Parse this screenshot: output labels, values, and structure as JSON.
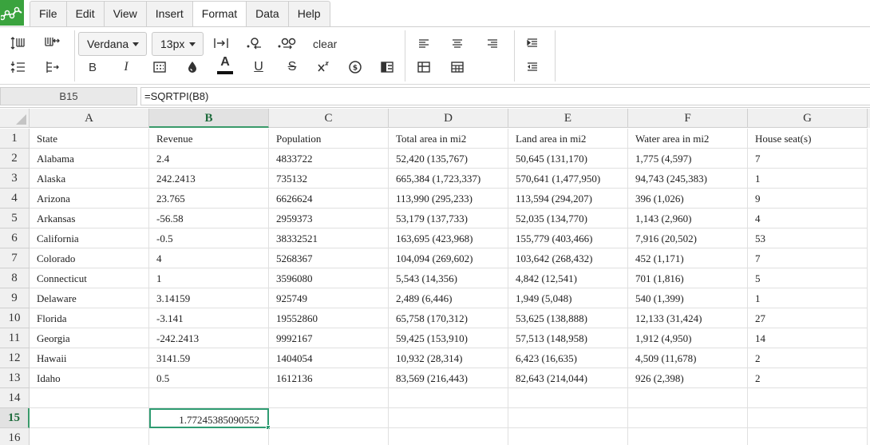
{
  "menu": {
    "tabs": [
      "File",
      "Edit",
      "View",
      "Insert",
      "Format",
      "Data",
      "Help"
    ],
    "active": "Format"
  },
  "toolbar": {
    "font_family": "Verdana",
    "font_size": "13px",
    "clear_label": "clear",
    "bold_label": "B",
    "italic_label": "I",
    "underline_label": "U",
    "strike_label": "S",
    "font_color_label": "A",
    "accent_color": "#3aa33e"
  },
  "formula_bar": {
    "cell_ref": "B15",
    "formula": "=SQRTPI(B8)"
  },
  "sheet": {
    "columns": [
      "A",
      "B",
      "C",
      "D",
      "E",
      "F",
      "G"
    ],
    "selected_column": "B",
    "selected_row": "15",
    "row_numbers": [
      "1",
      "2",
      "3",
      "4",
      "5",
      "6",
      "7",
      "8",
      "9",
      "10",
      "11",
      "12",
      "13",
      "14",
      "15",
      "16"
    ],
    "rows": [
      [
        "State",
        "Revenue",
        "Population",
        "Total area in mi2",
        "Land area in mi2",
        "Water area in mi2",
        "House seat(s)"
      ],
      [
        "Alabama",
        "2.4",
        "4833722",
        "52,420 (135,767)",
        "50,645 (131,170)",
        "1,775 (4,597)",
        "7"
      ],
      [
        "Alaska",
        "242.2413",
        "735132",
        "665,384 (1,723,337)",
        "570,641 (1,477,950)",
        "94,743 (245,383)",
        "1"
      ],
      [
        "Arizona",
        "23.765",
        "6626624",
        "113,990 (295,233)",
        "113,594 (294,207)",
        "396 (1,026)",
        "9"
      ],
      [
        "Arkansas",
        "-56.58",
        "2959373",
        "53,179 (137,733)",
        "52,035 (134,770)",
        "1,143 (2,960)",
        "4"
      ],
      [
        "California",
        "-0.5",
        "38332521",
        "163,695 (423,968)",
        "155,779 (403,466)",
        "7,916 (20,502)",
        "53"
      ],
      [
        "Colorado",
        "4",
        "5268367",
        "104,094 (269,602)",
        "103,642 (268,432)",
        "452 (1,171)",
        "7"
      ],
      [
        "Connecticut",
        "1",
        "3596080",
        "5,543 (14,356)",
        "4,842 (12,541)",
        "701 (1,816)",
        "5"
      ],
      [
        "Delaware",
        "3.14159",
        "925749",
        "2,489 (6,446)",
        "1,949 (5,048)",
        "540 (1,399)",
        "1"
      ],
      [
        "Florida",
        "-3.141",
        "19552860",
        "65,758 (170,312)",
        "53,625 (138,888)",
        "12,133 (31,424)",
        "27"
      ],
      [
        "Georgia",
        "-242.2413",
        "9992167",
        "59,425 (153,910)",
        "57,513 (148,958)",
        "1,912 (4,950)",
        "14"
      ],
      [
        "Hawaii",
        "3141.59",
        "1404054",
        "10,932 (28,314)",
        "6,423 (16,635)",
        "4,509 (11,678)",
        "2"
      ],
      [
        "Idaho",
        "0.5",
        "1612136",
        "83,569 (216,443)",
        "82,643 (214,044)",
        "926 (2,398)",
        "2"
      ],
      [
        "",
        "",
        "",
        "",
        "",
        "",
        ""
      ],
      [
        "",
        "1.77245385090552",
        "",
        "",
        "",
        "",
        ""
      ],
      [
        "",
        "",
        "",
        "",
        "",
        "",
        ""
      ]
    ]
  }
}
